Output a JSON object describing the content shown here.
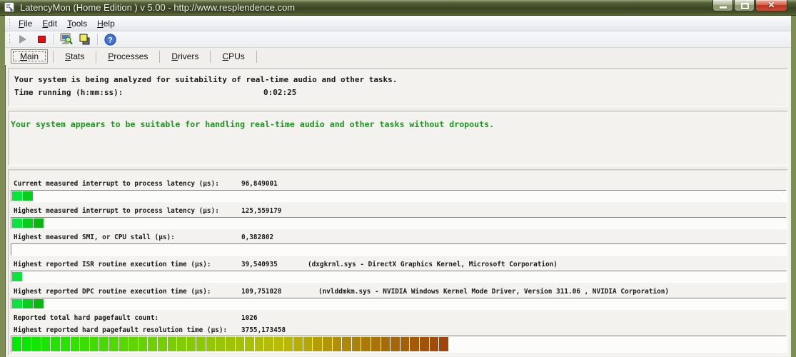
{
  "window": {
    "title": "LatencyMon  (Home Edition )  v 5.00 - http://www.resplendence.com"
  },
  "menu": {
    "items": [
      {
        "label": "File"
      },
      {
        "label": "Edit"
      },
      {
        "label": "Tools"
      },
      {
        "label": "Help"
      }
    ]
  },
  "tabs": [
    {
      "label": "Main",
      "active": true
    },
    {
      "label": "Stats",
      "active": false
    },
    {
      "label": "Processes",
      "active": false
    },
    {
      "label": "Drivers",
      "active": false
    },
    {
      "label": "CPUs",
      "active": false
    }
  ],
  "analysis": {
    "line1": "Your system is being analyzed for suitability of real-time audio and other tasks.",
    "time_label": "Time running (h:mm:ss):",
    "time_value": "0:02:25"
  },
  "verdict": {
    "text": "Your system appears to be suitable for handling real-time audio and other tasks without dropouts.",
    "color": "#1f9522"
  },
  "stats": {
    "small_block_colors": [
      "#0ae43c",
      "#09cd1d",
      "#0ab612"
    ],
    "gradient": {
      "hue_start": 120,
      "hue_end": 24,
      "sat_start": 100,
      "sat_end": 88,
      "light_start": 46,
      "light_end": 33
    },
    "rows": [
      {
        "label": "Current measured interrupt to process latency (µs):",
        "value": "96,849001",
        "extra": "",
        "bar": {
          "blocks": 2
        }
      },
      {
        "label": "Highest measured interrupt to process latency (µs):",
        "value": "125,559179",
        "extra": "",
        "bar": {
          "blocks": 3
        }
      },
      {
        "label": "Highest measured SMI, or CPU stall (µs):",
        "value": "0,382802",
        "extra": "",
        "bar": {
          "blocks": 0
        }
      },
      {
        "label": "Highest reported ISR routine execution time (µs):",
        "value": "39,540935",
        "extra": "(dxgkrnl.sys - DirectX Graphics Kernel, Microsoft Corporation)",
        "bar": {
          "blocks": 1
        }
      },
      {
        "label": "Highest reported DPC routine execution time (µs):",
        "value": "109,751028",
        "extra": "(nvlddmkm.sys - NVIDIA Windows Kernel Mode Driver, Version 311.06 , NVIDIA Corporation)",
        "bar": {
          "blocks": 3
        }
      },
      {
        "label": "Reported total hard pagefault count:",
        "value": "1026",
        "extra": "",
        "bar": null
      },
      {
        "label": "Highest reported hard pagefault resolution time (µs):",
        "value": "3755,173458",
        "extra": "",
        "bar": {
          "gradient": true,
          "count": 45
        }
      }
    ]
  }
}
